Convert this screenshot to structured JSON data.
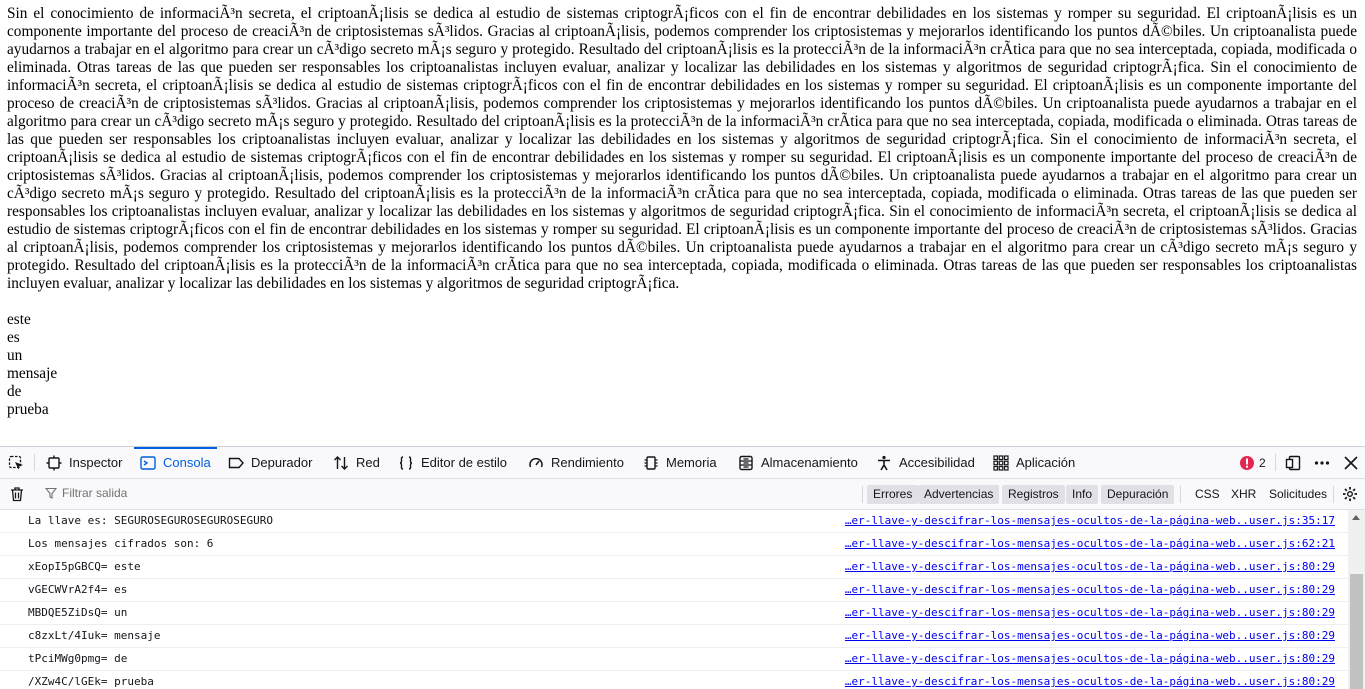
{
  "page": {
    "paragraph": "Sin el conocimiento de informaciÃ³n secreta, el criptoanÃ¡lisis se dedica al estudio de sistemas criptogrÃ¡ficos con el fin de encontrar debilidades en los sistemas y romper su seguridad. El criptoanÃ¡lisis es un componente importante del proceso de creaciÃ³n de criptosistemas sÃ³lidos. Gracias al criptoanÃ¡lisis, podemos comprender los criptosistemas y mejorarlos identificando los puntos dÃ©biles. Un criptoanalista puede ayudarnos a trabajar en el algoritmo para crear un cÃ³digo secreto mÃ¡s seguro y protegido. Resultado del criptoanÃ¡lisis es la protecciÃ³n de la informaciÃ³n crÃtica para que no sea interceptada, copiada, modificada o eliminada. Otras tareas de las que pueden ser responsables los criptoanalistas incluyen evaluar, analizar y localizar las debilidades en los sistemas y algoritmos de seguridad criptogrÃ¡fica.",
    "words": [
      "este",
      "es",
      "un",
      "mensaje",
      "de",
      "prueba"
    ]
  },
  "devtools": {
    "tabs": [
      {
        "label": "Inspector",
        "icon": "inspector-icon"
      },
      {
        "label": "Consola",
        "icon": "console-icon",
        "active": true
      },
      {
        "label": "Depurador",
        "icon": "debugger-icon"
      },
      {
        "label": "Red",
        "icon": "network-icon"
      },
      {
        "label": "Editor de estilo",
        "icon": "style-editor-icon"
      },
      {
        "label": "Rendimiento",
        "icon": "performance-icon"
      },
      {
        "label": "Memoria",
        "icon": "memory-icon"
      },
      {
        "label": "Almacenamiento",
        "icon": "storage-icon"
      },
      {
        "label": "Accesibilidad",
        "icon": "accessibility-icon"
      },
      {
        "label": "Aplicación",
        "icon": "application-icon"
      }
    ],
    "error_count": "2",
    "filter_placeholder": "Filtrar salida",
    "filter_chips": [
      "Errores",
      "Advertencias",
      "Registros",
      "Info",
      "Depuración"
    ],
    "filter_plain": [
      "CSS",
      "XHR",
      "Solicitudes"
    ],
    "messages": [
      {
        "text": "La llave es: SEGUROSEGUROSEGUROSEGURO",
        "source": "…er-llave-y-descifrar-los-mensajes-ocultos-de-la-página-web..user.js:35:17"
      },
      {
        "text": "Los mensajes cifrados son: 6",
        "source": "…er-llave-y-descifrar-los-mensajes-ocultos-de-la-página-web..user.js:62:21"
      },
      {
        "text": "xEopI5pGBCQ= este",
        "source": "…er-llave-y-descifrar-los-mensajes-ocultos-de-la-página-web..user.js:80:29"
      },
      {
        "text": "vGECWVrA2f4= es",
        "source": "…er-llave-y-descifrar-los-mensajes-ocultos-de-la-página-web..user.js:80:29"
      },
      {
        "text": "MBDQE5ZiDsQ= un",
        "source": "…er-llave-y-descifrar-los-mensajes-ocultos-de-la-página-web..user.js:80:29"
      },
      {
        "text": "c8zxLt/4Iuk= mensaje",
        "source": "…er-llave-y-descifrar-los-mensajes-ocultos-de-la-página-web..user.js:80:29"
      },
      {
        "text": "tPciMWg0pmg= de",
        "source": "…er-llave-y-descifrar-los-mensajes-ocultos-de-la-página-web..user.js:80:29"
      },
      {
        "text": "/XZw4C/lGEk= prueba",
        "source": "…er-llave-y-descifrar-los-mensajes-ocultos-de-la-página-web..user.js:80:29"
      }
    ],
    "colors": {
      "accent": "#0060df",
      "error": "#e22850",
      "link": "#0000ee"
    }
  }
}
